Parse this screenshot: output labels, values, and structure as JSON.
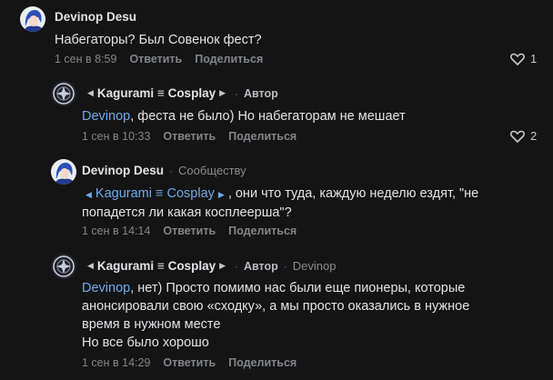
{
  "colors": {
    "background": "#141414",
    "mention": "#71aaeb",
    "muted": "#828589"
  },
  "comments": [
    {
      "author": "Devinop Desu",
      "text": "Набегаторы? Был Совенок фест?",
      "date": "1 сен в 8:59",
      "reply": "Ответить",
      "share": "Поделиться",
      "likes": "1",
      "avatar_icon": "anime-avatar-icon"
    },
    {
      "author": "Kagurami ≡ Cosplay",
      "badge": "Автор",
      "mention": "Devinop",
      "text": ", феста не было) Но набегаторам не мешает",
      "date": "1 сен в 10:33",
      "reply": "Ответить",
      "share": "Поделиться",
      "likes": "2",
      "avatar_icon": "logo-avatar-icon"
    },
    {
      "author": "Devinop Desu",
      "to": "Сообществу",
      "mention": "Kagurami ≡ Cosplay",
      "text_line1": ", они что туда, каждую неделю ездят, \"не",
      "text_line2": "попадется ли какая косплеерша\"?",
      "date": "1 сен в 14:14",
      "reply": "Ответить",
      "share": "Поделиться",
      "avatar_icon": "anime-avatar-icon"
    },
    {
      "author": "Kagurami ≡ Cosplay",
      "badge": "Автор",
      "to": "Devinop",
      "mention": "Devinop",
      "text_line1": ", нет) Просто помимо нас были еще пионеры, которые",
      "text_line2": "анонсировали свою «сходку», а мы просто оказались в нужное",
      "text_line3": "время в нужном месте",
      "text_line4": "Но все было хорошо",
      "date": "1 сен в 14:29",
      "reply": "Ответить",
      "share": "Поделиться",
      "avatar_icon": "logo-avatar-icon"
    }
  ]
}
